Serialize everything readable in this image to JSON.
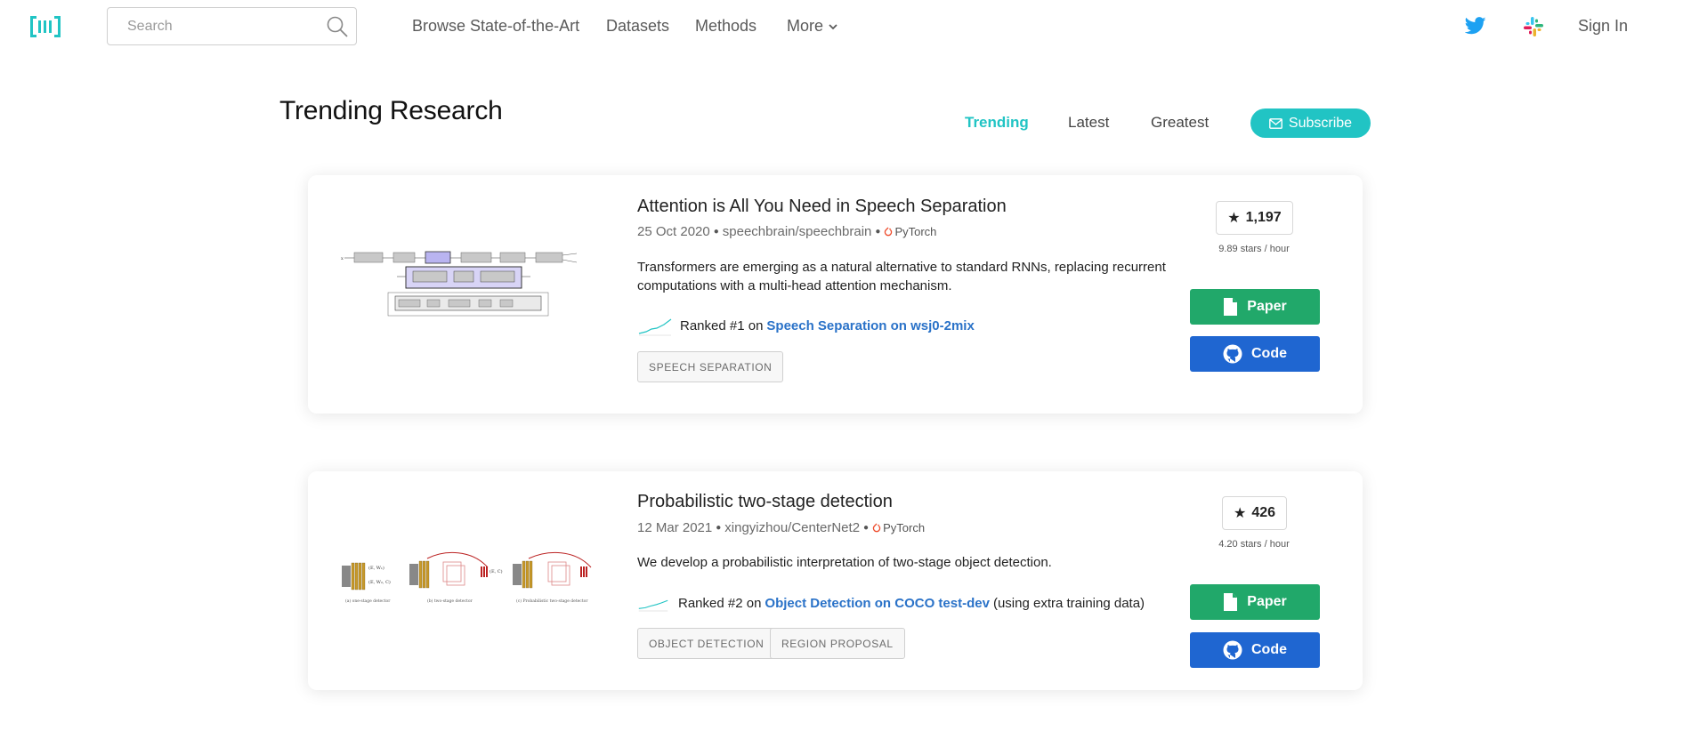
{
  "nav": {
    "search_placeholder": "Search",
    "links": [
      "Browse State-of-the-Art",
      "Datasets",
      "Methods",
      "More"
    ],
    "sign_in": "Sign In",
    "icons": [
      "logo-icon",
      "search-icon",
      "twitter-icon",
      "slack-icon",
      "chevron-down-icon"
    ]
  },
  "header": {
    "title": "Trending Research",
    "tabs": [
      "Trending",
      "Latest",
      "Greatest"
    ],
    "active_tab": "Trending",
    "subscribe_label": "Subscribe"
  },
  "colors": {
    "accent": "#21c4c4",
    "paper_button": "#21a86a",
    "code_button": "#1f66d1",
    "link": "#2a72c8"
  },
  "papers": [
    {
      "title": "Attention is All You Need in Speech Separation",
      "date": "25 Oct 2020",
      "repo": "speechbrain/speechbrain",
      "framework": "PyTorch",
      "abstract": "Transformers are emerging as a natural alternative to standard RNNs, replacing recurrent computations with a multi-head attention mechanism.",
      "rank_prefix": "Ranked #1 on",
      "rank_task": "Speech Separation on wsj0-2mix",
      "rank_suffix": "",
      "tags": [
        "SPEECH SEPARATION"
      ],
      "stars": "1,197",
      "stars_rate": "9.89 stars / hour",
      "paper_label": "Paper",
      "code_label": "Code"
    },
    {
      "title": "Probabilistic two-stage detection",
      "date": "12 Mar 2021",
      "repo": "xingyizhou/CenterNet2",
      "framework": "PyTorch",
      "abstract": "We develop a probabilistic interpretation of two-stage object detection.",
      "rank_prefix": "Ranked #2 on",
      "rank_task": "Object Detection on COCO test-dev",
      "rank_suffix": "(using extra training data)",
      "tags": [
        "OBJECT DETECTION",
        "REGION PROPOSAL"
      ],
      "stars": "426",
      "stars_rate": "4.20 stars / hour",
      "paper_label": "Paper",
      "code_label": "Code"
    }
  ]
}
